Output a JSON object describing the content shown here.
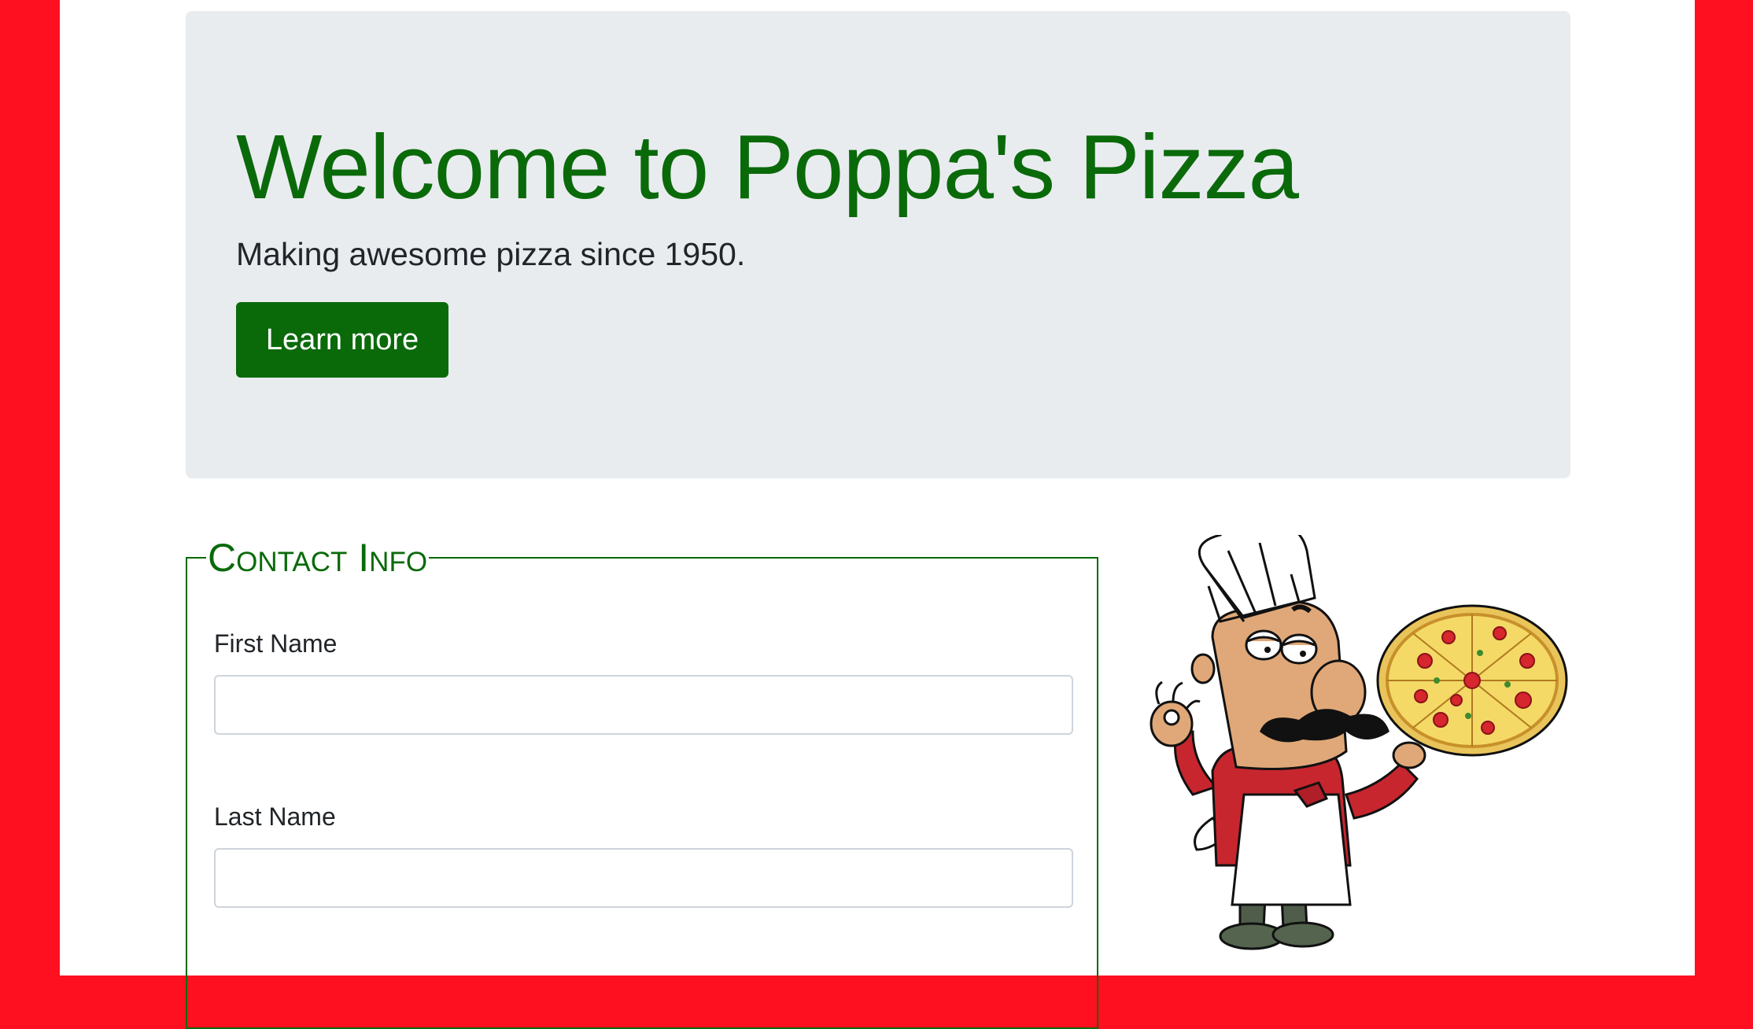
{
  "hero": {
    "title": "Welcome to Poppa's Pizza",
    "lead": "Making awesome pizza since 1950.",
    "button_label": "Learn more"
  },
  "contact": {
    "legend": "Contact Info",
    "fields": [
      {
        "label": "First Name",
        "value": "",
        "placeholder": ""
      },
      {
        "label": "Last Name",
        "value": "",
        "placeholder": ""
      }
    ]
  },
  "illustration": {
    "icon": "pizza-chef-icon"
  },
  "colors": {
    "side_rail": "#ff1020",
    "brand_green": "#0a6a0a",
    "jumbotron_bg": "#e9ecef"
  }
}
